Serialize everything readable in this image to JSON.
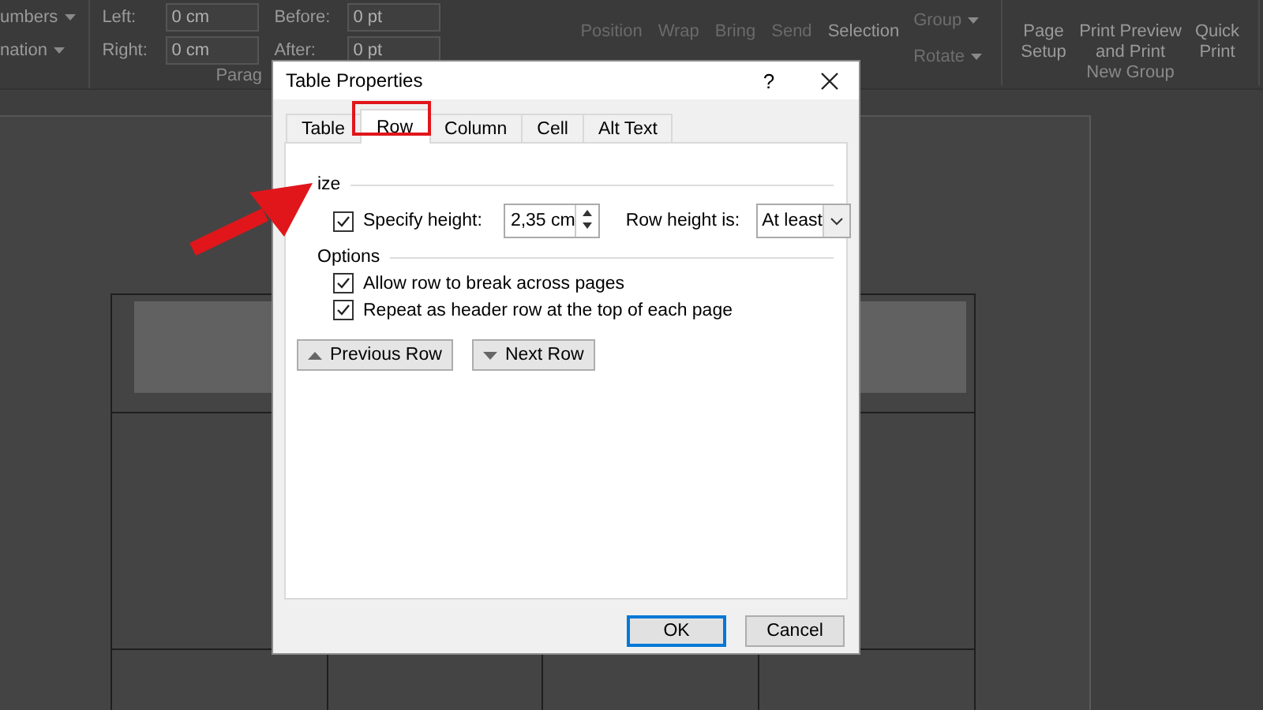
{
  "ribbon": {
    "list_items": [
      {
        "label": "umbers"
      },
      {
        "label": "nation"
      }
    ],
    "indent": [
      {
        "label": "Left:",
        "value": "0 cm"
      },
      {
        "label": "Right:",
        "value": "0 cm"
      }
    ],
    "spacing": [
      {
        "label": "Before:",
        "value": "0 pt"
      },
      {
        "label": "After:",
        "value": "0 pt"
      }
    ],
    "paragraph_group": "Parag",
    "arrange": [
      "Position",
      "Wrap",
      "Bring",
      "Send",
      "Selection"
    ],
    "small": [
      {
        "label": "Group",
        "disabled": true
      },
      {
        "label": "Rotate",
        "disabled": true
      }
    ],
    "new_group": {
      "buttons": [
        "Page Setup",
        "Print Preview and Print",
        "Quick Print"
      ],
      "label": "New Group"
    }
  },
  "dialog": {
    "title": "Table Properties",
    "help": "?",
    "tabs": [
      {
        "label": "Table",
        "selected": false
      },
      {
        "label": "Row",
        "selected": true
      },
      {
        "label": "Column",
        "selected": false
      },
      {
        "label": "Cell",
        "selected": false
      },
      {
        "label": "Alt Text",
        "selected": false
      }
    ],
    "size_group": "ize",
    "specify_height": {
      "label": "Specify height:",
      "checked": true,
      "value": "2,35 cm"
    },
    "row_height_is": {
      "label": "Row height is:",
      "value": "At least"
    },
    "options_group": "Options",
    "options": [
      {
        "label": "Allow row to break across pages",
        "checked": true
      },
      {
        "label": "Repeat as header row at the top of each page",
        "checked": true
      }
    ],
    "nav_buttons": [
      {
        "label": "Previous Row",
        "kind": "up"
      },
      {
        "label": "Next Row",
        "kind": "down"
      }
    ],
    "buttons": [
      {
        "label": "OK",
        "kind": "default"
      },
      {
        "label": "Cancel",
        "kind": "normal"
      }
    ]
  }
}
